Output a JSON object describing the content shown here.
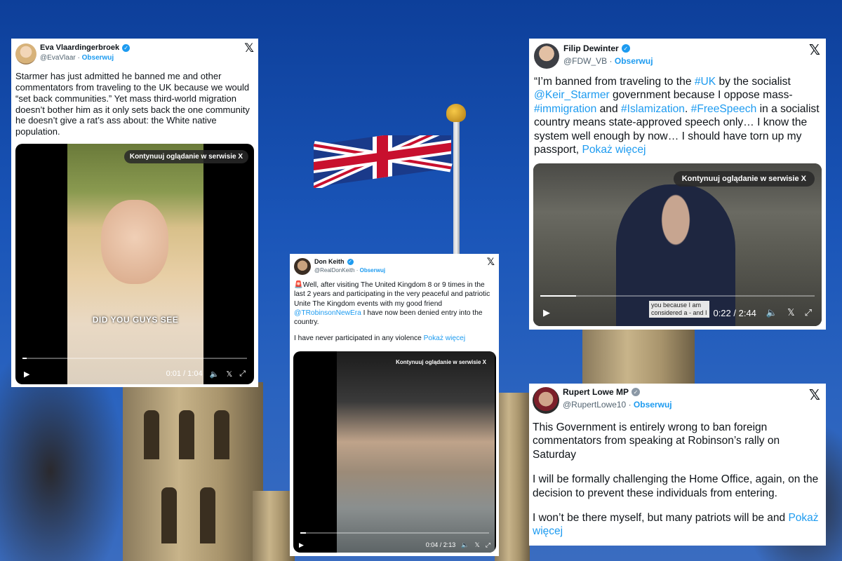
{
  "continue_label": "Kontynuuj oglądanie w serwisie X",
  "follow_label": "Obserwuj",
  "more_label": "Pokaż więcej",
  "brand_color": "#1d9bf0",
  "tweets": [
    {
      "name": "Eva Vlaardingerbroek",
      "handle": "@EvaVlaar",
      "verified": "blue",
      "text": "Starmer has just admitted he banned me and other commentators from traveling to the UK because we would “set back communities.” Yet mass third-world migration doesn’t bother him as it only sets back the one community he doesn’t give a rat’s ass about: the White native population.",
      "video": {
        "caption": "DID YOU GUYS SEE",
        "time": "0:01 / 1:04",
        "progress": 0.02
      }
    },
    {
      "name": "Don Keith",
      "handle": "@RealDonKeith",
      "verified": "blue",
      "text_pre": "🚨Well, after visiting The United Kingdom 8 or 9 times in the last 2 years and participating in the very peaceful and patriotic Unite The Kingdom events with my good friend ",
      "mention": "@TRobinsonNewEra",
      "text_post": " I have now been denied entry into the country.",
      "text2": "I have never participated in any violence ",
      "video": {
        "time": "0:04 / 2:13",
        "progress": 0.03
      }
    },
    {
      "name": "Filip Dewinter",
      "handle": "@FDW_VB",
      "verified": "blue",
      "t1": "“I’m banned from traveling to the ",
      "h_uk": "#UK",
      "t2": " by the socialist ",
      "m_starmer": "@Keir_Starmer",
      "t3": " government because I oppose mass-",
      "h_immigration": "#immigration",
      "t4": " and ",
      "h_islamization": "#Islamization",
      "t5": ". ",
      "h_freespeech": "#FreeSpeech",
      "t6": " in a socialist country means state-approved speech only… I know the system well enough by now… I should have torn up my passport, ",
      "video": {
        "subtitle_1": "you because I am",
        "subtitle_2": "considered a - and I",
        "time": "0:22 / 2:44",
        "progress": 0.13
      }
    },
    {
      "name": "Rupert Lowe MP",
      "handle": "@RupertLowe10",
      "verified": "gray",
      "p1": "This Government is entirely wrong to ban foreign commentators from speaking at Robinson’s rally on Saturday",
      "p2": "I will be formally challenging the Home Office, again, on the decision to prevent these individuals from entering.",
      "p3": "I won’t be there myself, but many patriots will be and "
    }
  ]
}
